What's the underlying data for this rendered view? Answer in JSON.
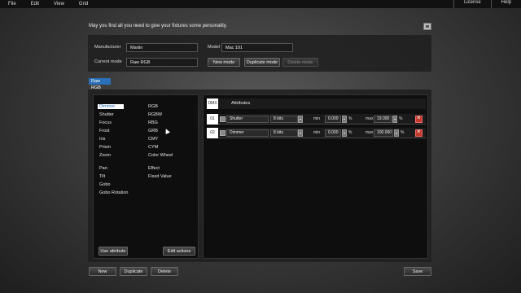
{
  "menu": {
    "left": [
      "File",
      "Edit",
      "View",
      "Grid"
    ],
    "right": [
      "License",
      "Help"
    ]
  },
  "intro_text": "May you find all you need to give your fixtures some personality.",
  "top": {
    "manufacturer_label": "Manufacturer",
    "manufacturer_value": "Martin",
    "model_label": "Model",
    "model_value": "Mac 101",
    "mode_label": "Current mode",
    "mode_value": "Raw RGB",
    "new_mode": "New mode",
    "duplicate_mode": "Duplicate mode",
    "delete_mode": "Delete mode"
  },
  "mode_tab": "Raw RGB",
  "attributes_col1": [
    "Dimmer",
    "Shutter",
    "Focus",
    "Frost",
    "Iris",
    "Prism",
    "Zoom",
    "",
    "Pan",
    "Tilt",
    "Gobo",
    "Gobo Rotation"
  ],
  "attributes_col2": [
    "RGB",
    "RGBW",
    "RBG",
    "GRB",
    "CMY",
    "CYM",
    "Color Wheel",
    "",
    "Effect",
    "Fixed Value"
  ],
  "left_buttons": {
    "use": "Use attribute",
    "edit": "Edit actions"
  },
  "table": {
    "dmx_label": "DMX",
    "attributes_label": "Attributes",
    "min_label": "min",
    "max_label": "max",
    "pct": "%",
    "rows": [
      {
        "num": "01",
        "name": "Shutter",
        "bits": "8 bits",
        "min": "0.000",
        "max": "19.000"
      },
      {
        "num": "02",
        "name": "Dimmer",
        "bits": "8 bits",
        "min": "0.000",
        "max": "100.000"
      }
    ]
  },
  "bottom": {
    "new": "New",
    "duplicate": "Duplicate",
    "delete": "Delete",
    "save": "Save"
  }
}
